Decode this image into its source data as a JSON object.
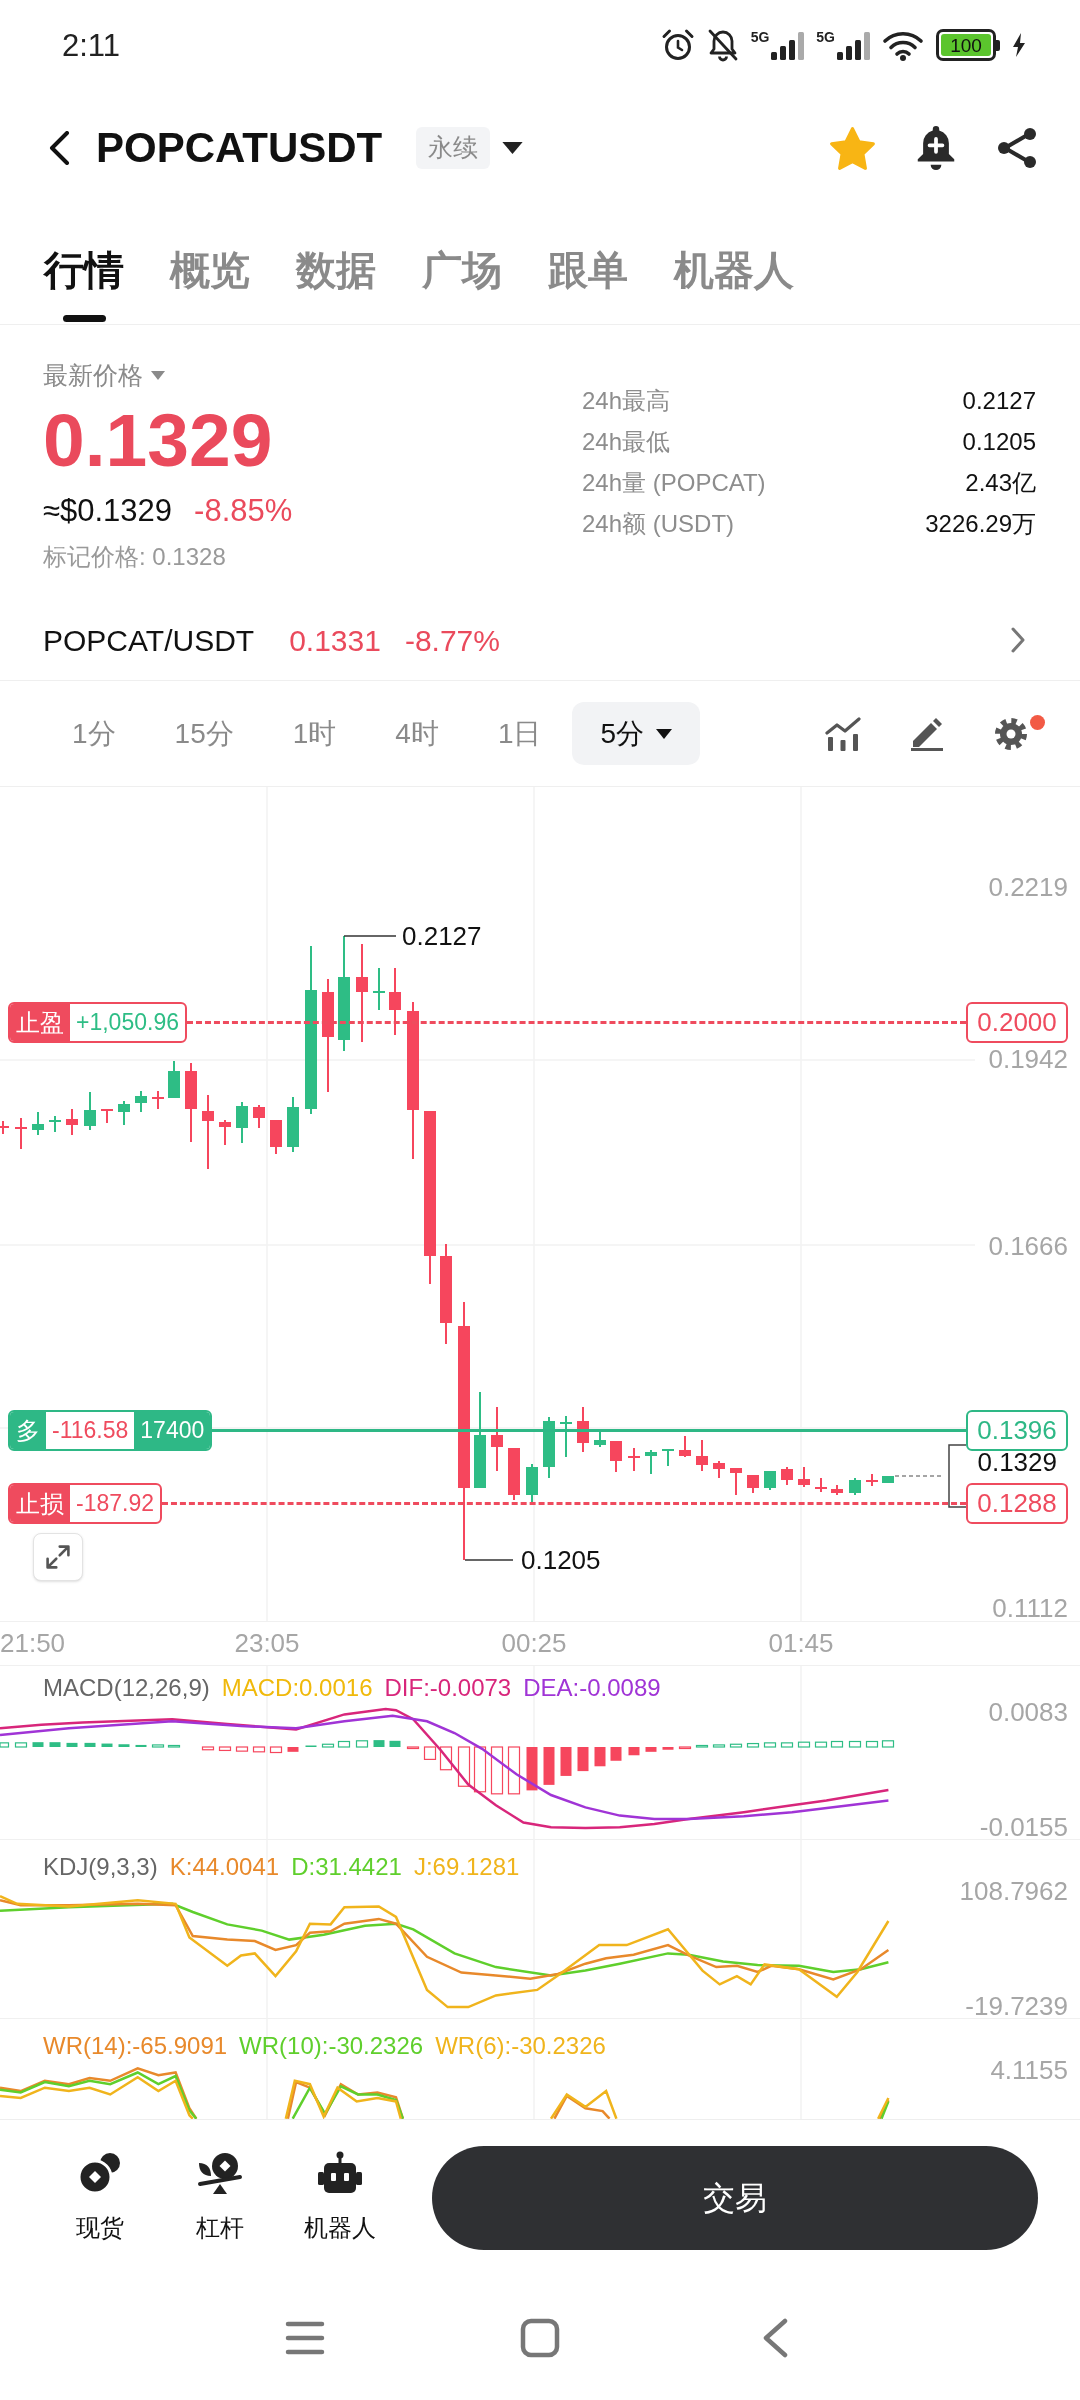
{
  "status_bar": {
    "time": "2:11",
    "networks": [
      "5G",
      "5G"
    ],
    "battery": "100"
  },
  "header": {
    "title": "POPCATUSDT",
    "badge": "永续",
    "favorite": true
  },
  "tabs": [
    {
      "label": "行情",
      "selected": true
    },
    {
      "label": "概览",
      "selected": false
    },
    {
      "label": "数据",
      "selected": false
    },
    {
      "label": "广场",
      "selected": false
    },
    {
      "label": "跟单",
      "selected": false
    },
    {
      "label": "机器人",
      "selected": false
    }
  ],
  "price": {
    "label": "最新价格",
    "last": "0.1329",
    "usd": "≈$0.1329",
    "change": "-8.85%",
    "falling": true,
    "mark_price": "标记价格: 0.1328"
  },
  "stats": [
    {
      "label": "24h最高",
      "value": "0.2127"
    },
    {
      "label": "24h最低",
      "value": "0.1205"
    },
    {
      "label": "24h量 (POPCAT)",
      "value": "2.43亿"
    },
    {
      "label": "24h额 (USDT)",
      "value": "3226.29万"
    }
  ],
  "spot": {
    "pair": "POPCAT/USDT",
    "price": "0.1331",
    "change": "-8.77%",
    "falling": true
  },
  "intervals": [
    {
      "label": "1分",
      "kind": "button",
      "selected": false
    },
    {
      "label": "15分",
      "kind": "button",
      "selected": false
    },
    {
      "label": "1时",
      "kind": "button",
      "selected": false
    },
    {
      "label": "4时",
      "kind": "button",
      "selected": false
    },
    {
      "label": "1日",
      "kind": "button",
      "selected": false
    },
    {
      "label": "5分",
      "kind": "dropdown",
      "selected": true
    }
  ],
  "toolbar": {
    "settings_badge": true
  },
  "chart": {
    "price_axis": [
      "0.2219",
      "0.1942",
      "0.1666",
      "0.1112"
    ],
    "high": "0.2127",
    "low": "0.1205",
    "current_price": "0.1329",
    "orders": [
      {
        "kind": "take_profit",
        "tag": "止盈",
        "pnl": "+1,050.96",
        "profit": true,
        "price": "0.2000"
      },
      {
        "kind": "position",
        "tag": "多",
        "pnl": "-116.58",
        "profit": false,
        "size": "17400",
        "price": "0.1396"
      },
      {
        "kind": "stop_loss",
        "tag": "止损",
        "pnl": "-187.92",
        "profit": false,
        "price": "0.1288"
      }
    ],
    "time_axis": [
      "21:50",
      "23:05",
      "00:25",
      "01:45"
    ]
  },
  "indicators": [
    {
      "kind": "macd",
      "name": "MACD(12,26,9)",
      "values": [
        {
          "text": "MACD:0.0016",
          "color": "#f0b90b"
        },
        {
          "text": "DIF:-0.0073",
          "color": "#d8267b"
        },
        {
          "text": "DEA:-0.0089",
          "color": "#a034d6"
        }
      ],
      "axis": [
        "0.0083",
        "-0.0155"
      ]
    },
    {
      "kind": "kdj",
      "name": "KDJ(9,3,3)",
      "values": [
        {
          "text": "K:44.0041",
          "color": "#e8892b"
        },
        {
          "text": "D:31.4421",
          "color": "#5fcf2c"
        },
        {
          "text": "J:69.1281",
          "color": "#f0b41c"
        }
      ],
      "axis": [
        "108.7962",
        "-19.7239"
      ]
    },
    {
      "kind": "wr",
      "values": [
        {
          "text": "WR(14):-65.9091",
          "color": "#e8892b"
        },
        {
          "text": "WR(10):-30.2326",
          "color": "#5fcf2c"
        },
        {
          "text": "WR(6):-30.2326",
          "color": "#f0b41c"
        }
      ],
      "axis": [
        "4.1155"
      ]
    }
  ],
  "bottom_bar": {
    "items": [
      {
        "label": "现货"
      },
      {
        "label": "杠杆"
      },
      {
        "label": "机器人"
      }
    ],
    "trade": "交易"
  }
}
